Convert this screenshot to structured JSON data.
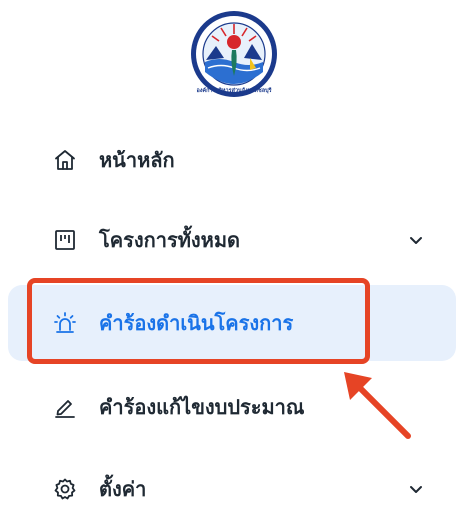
{
  "logo": {
    "text": "องค์การบริหารส่วนจังหวัดชลบุรี",
    "icon": "chonburi-pao-seal-icon"
  },
  "nav": {
    "items": [
      {
        "label": "หน้าหลัก",
        "icon": "home-icon",
        "has_submenu": false,
        "active": false
      },
      {
        "label": "โครงการทั้งหมด",
        "icon": "kanban-board-icon",
        "has_submenu": true,
        "active": false
      },
      {
        "label": "คำร้องดำเนินโครงการ",
        "icon": "siren-alert-icon",
        "has_submenu": false,
        "active": true
      },
      {
        "label": "คำร้องแก้ไขงบประมาณ",
        "icon": "pencil-edit-icon",
        "has_submenu": false,
        "active": false
      },
      {
        "label": "ตั้งค่า",
        "icon": "gear-icon",
        "has_submenu": true,
        "active": false
      }
    ]
  },
  "annotation": {
    "highlight_color": "#e64425",
    "highlighted_item": "คำร้องดำเนินโครงการ"
  },
  "colors": {
    "active_bg": "#e7f0fc",
    "active_text": "#1a73e8",
    "text": "#1f2933"
  }
}
